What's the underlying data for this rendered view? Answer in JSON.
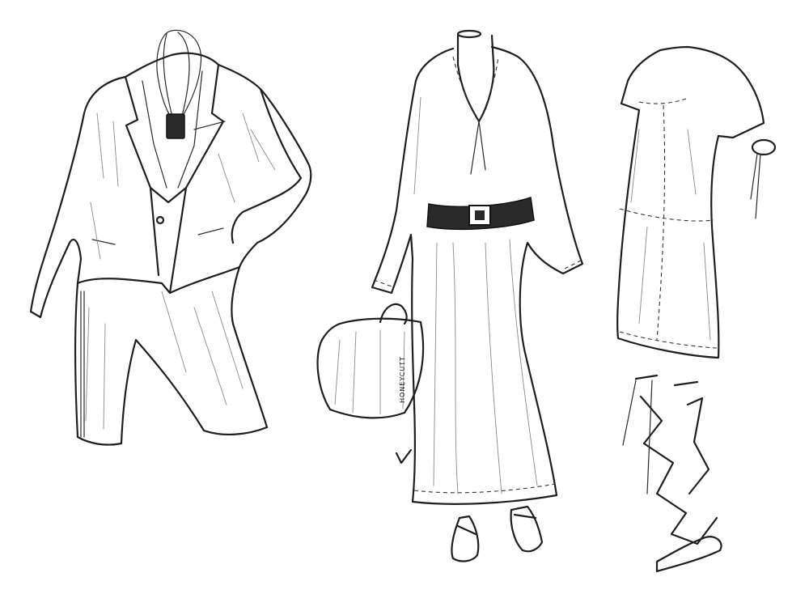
{
  "artwork": {
    "signature_text": "HONEYCUTT",
    "colors": {
      "ink": "#1e1e1e",
      "paper": "#ffffff"
    }
  }
}
